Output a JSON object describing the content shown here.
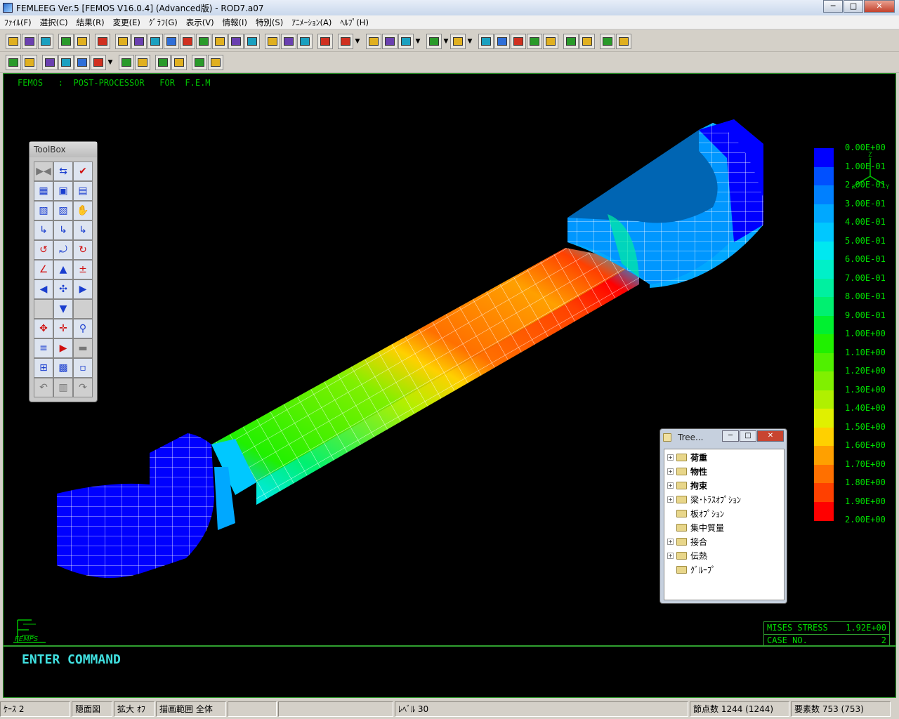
{
  "window": {
    "title": "FEMLEEG Ver.5 [FEMOS V16.0.4] (Advanced版) - ROD7.a07",
    "minimize": "─",
    "maximize": "□",
    "close": "✕"
  },
  "menu": [
    "ﾌｧｲﾙ(F)",
    "選択(C)",
    "結果(R)",
    "変更(E)",
    "ｸﾞﾗﾌ(G)",
    "表示(V)",
    "情報(I)",
    "特別(S)",
    "ｱﾆﾒｰｼｮﾝ(A)",
    "ﾍﾙﾌﾟ(H)"
  ],
  "viewport": {
    "header": "FEMOS   :  POST-PROCESSOR   FOR  F.E.M",
    "axis_labels": {
      "z": "Z",
      "x": "X",
      "y": "Y"
    },
    "logo_text": "FEMPS"
  },
  "legend": {
    "labels": [
      "0.00E+00",
      "1.00E-01",
      "2.00E-01",
      "3.00E-01",
      "4.00E-01",
      "5.00E-01",
      "6.00E-01",
      "7.00E-01",
      "8.00E-01",
      "9.00E-01",
      "1.00E+00",
      "1.10E+00",
      "1.20E+00",
      "1.30E+00",
      "1.40E+00",
      "1.50E+00",
      "1.60E+00",
      "1.70E+00",
      "1.80E+00",
      "1.90E+00",
      "2.00E+00"
    ],
    "colors": [
      "#0000ff",
      "#0050ff",
      "#0080ff",
      "#00a8ff",
      "#00c8ff",
      "#00e8f0",
      "#00f0c8",
      "#00f0a0",
      "#00f070",
      "#00f030",
      "#20f000",
      "#50f000",
      "#80f000",
      "#b0f000",
      "#e0f000",
      "#ffd000",
      "#ffa000",
      "#ff7000",
      "#ff4000",
      "#ff0000"
    ]
  },
  "info": {
    "label1": "MISES STRESS",
    "value1": "1.92E+00",
    "label2": "CASE NO.",
    "value2": "2"
  },
  "command": {
    "text": "ENTER COMMAND"
  },
  "toolbox": {
    "title": "ToolBox",
    "glyphs": [
      "▶◀",
      "⇆",
      "✔",
      "▦",
      "▣",
      "▤",
      "▧",
      "▨",
      "✋",
      "↳",
      "↳",
      "↳",
      "↺",
      "⤾",
      "↻",
      "∠",
      "▲",
      "±",
      "◀",
      "✣",
      "▶",
      "",
      "▼",
      "",
      "✥",
      "✛",
      "⚲",
      "≡",
      "▶",
      "▬",
      "⊞",
      "▩",
      "▫",
      "↶",
      "▥",
      "↷"
    ],
    "colors": [
      "gray",
      "blue",
      "red",
      "blue",
      "blue",
      "blue",
      "blue",
      "blue",
      "blue",
      "blue",
      "blue",
      "blue",
      "red",
      "blue",
      "red",
      "red",
      "blue",
      "red",
      "blue",
      "blue",
      "blue",
      "gray",
      "blue",
      "gray",
      "red",
      "red",
      "blue",
      "blue",
      "red",
      "gray",
      "blue",
      "blue",
      "blue",
      "gray",
      "gray",
      "gray"
    ]
  },
  "tree": {
    "title": "Tree...",
    "nodes": [
      {
        "label": "荷重",
        "expand": "+",
        "bold": true
      },
      {
        "label": "物性",
        "expand": "+",
        "bold": true
      },
      {
        "label": "拘束",
        "expand": "+",
        "bold": true
      },
      {
        "label": "梁･ﾄﾗｽｵﾌﾟｼｮﾝ",
        "expand": "+",
        "bold": false
      },
      {
        "label": "板ｵﾌﾟｼｮﾝ",
        "expand": "",
        "bold": false
      },
      {
        "label": "集中質量",
        "expand": "",
        "bold": false
      },
      {
        "label": "接合",
        "expand": "+",
        "bold": false
      },
      {
        "label": "伝熱",
        "expand": "+",
        "bold": false
      },
      {
        "label": "ｸﾞﾙｰﾌﾟ",
        "expand": "",
        "bold": false
      }
    ]
  },
  "status": {
    "case": "ｹｰｽ 2",
    "hidden": "隠面図",
    "zoom": "拡大 ｵﾌ",
    "range": "描画範囲 全体",
    "level": "ﾚﾍﾞﾙ 30",
    "nodes": "節点数 1244 (1244)",
    "elements": "要素数 753 (753)"
  }
}
